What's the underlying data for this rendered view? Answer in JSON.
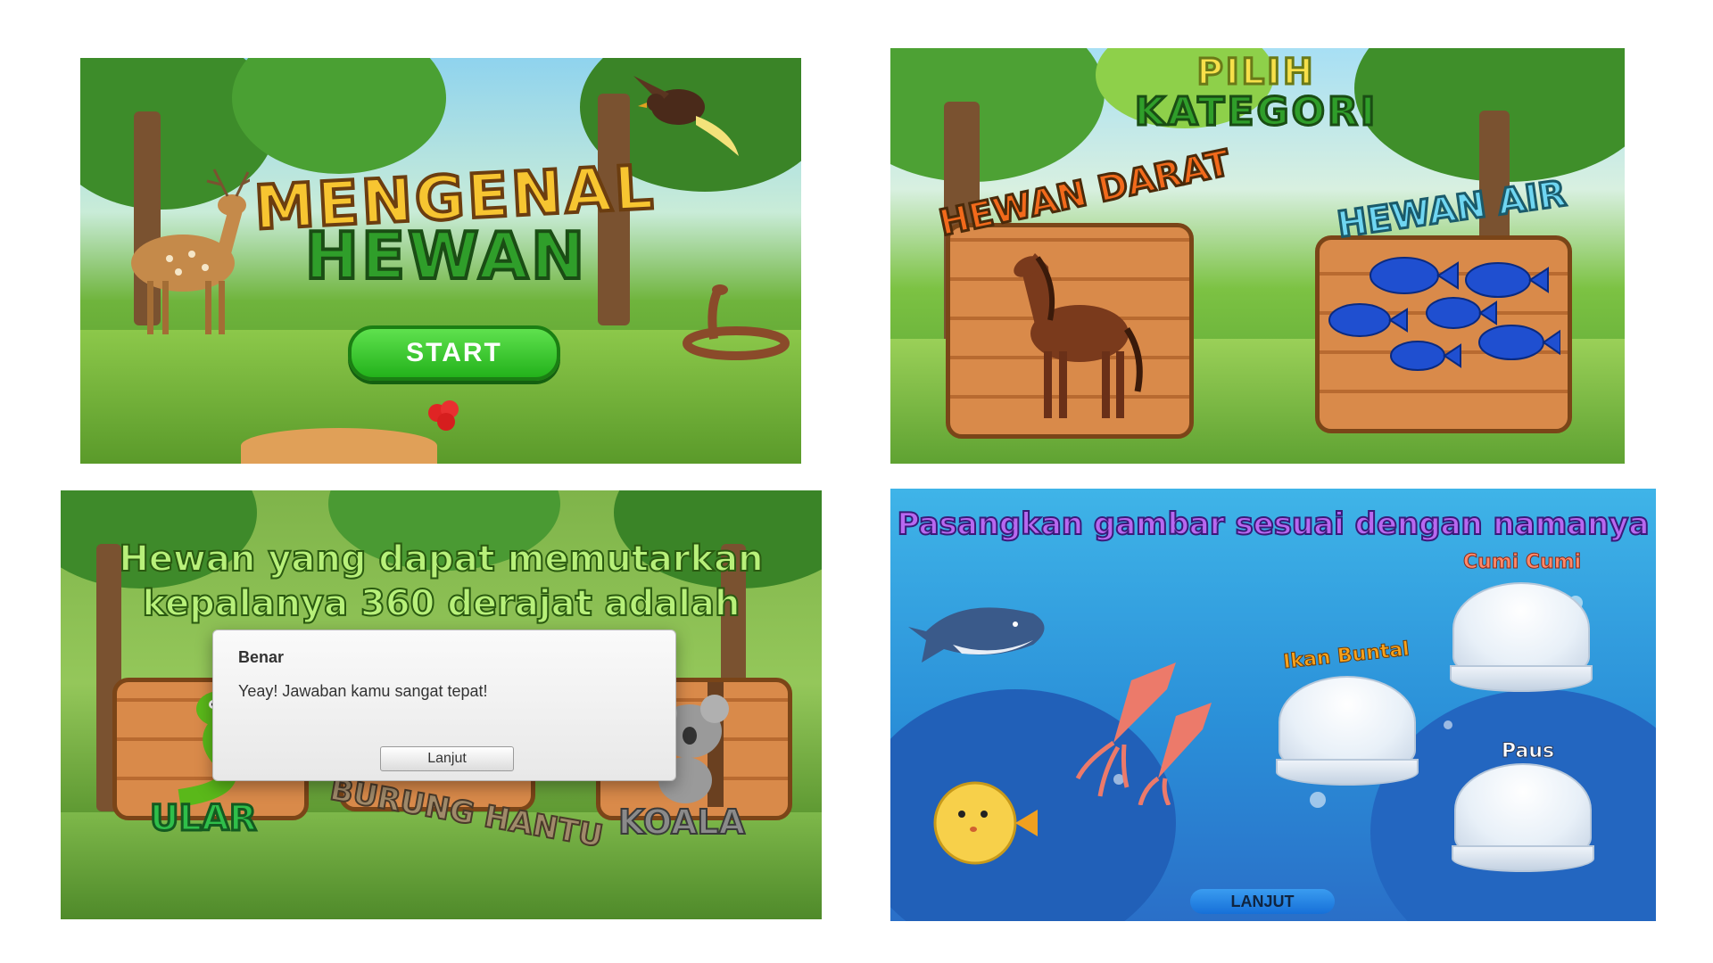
{
  "panel1": {
    "title_line1": "MENGENAL",
    "title_line2": "HEWAN",
    "start_label": "START",
    "colors": {
      "title1": "#f7c531",
      "title2": "#2f9e2a",
      "button": "#23b21b"
    }
  },
  "panel2": {
    "title_line1": "PILIH",
    "title_line2": "KATEGORI",
    "categories": [
      {
        "label": "HEWAN DARAT",
        "image": "horse",
        "color": "#f26a1b"
      },
      {
        "label": "HEWAN AIR",
        "image": "blue-fish",
        "color": "#6fd6f2"
      }
    ]
  },
  "panel3": {
    "question": "Hewan yang dapat memutarkan kepalanya 360 derajat adalah",
    "options": [
      "ULAR",
      "BURUNG HANTU",
      "KOALA"
    ],
    "dialog": {
      "title": "Benar",
      "message": "Yeay! Jawaban kamu sangat tepat!",
      "button": "Lanjut"
    }
  },
  "panel4": {
    "instruction": "Pasangkan gambar sesuai dengan namanya",
    "animals": [
      "whale",
      "squid",
      "pufferfish"
    ],
    "shell_labels": [
      "Cumi Cumi",
      "Ikan Buntal",
      "Paus"
    ],
    "button": "LANJUT"
  }
}
